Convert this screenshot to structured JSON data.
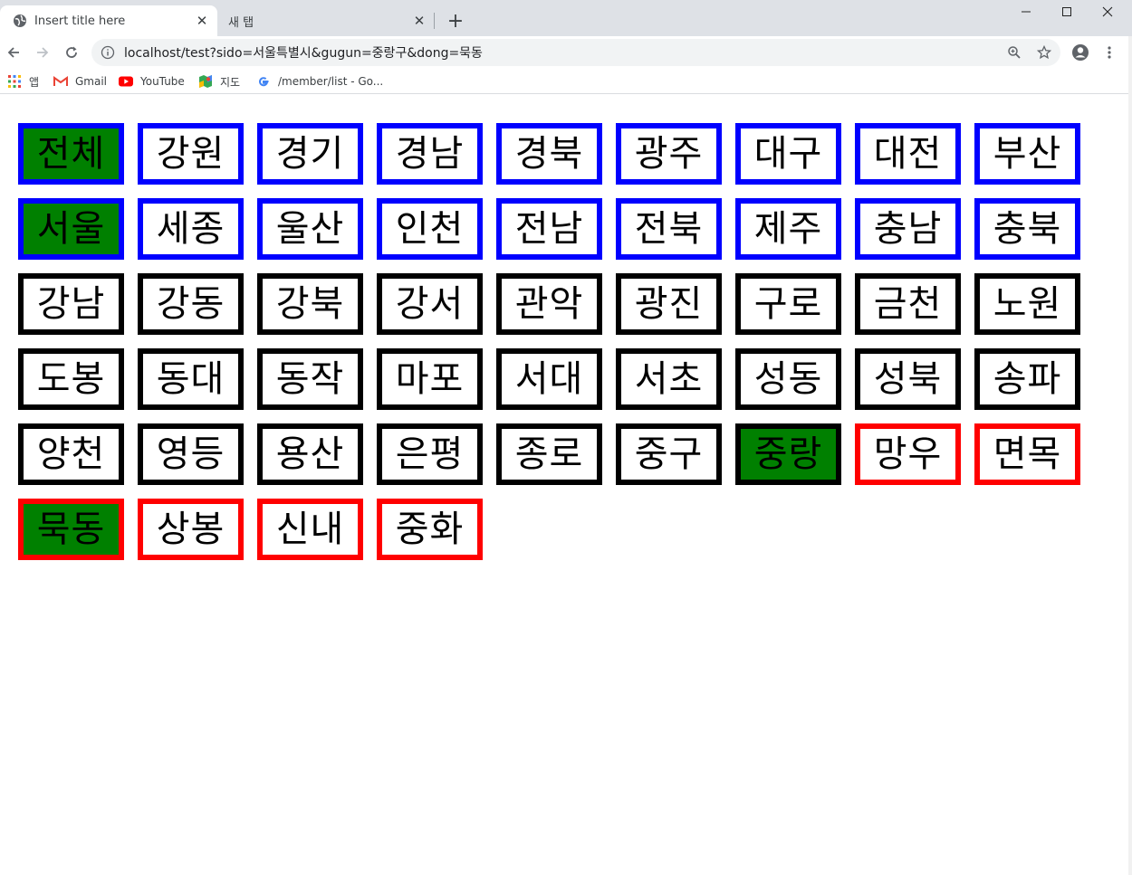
{
  "browser": {
    "tabs": [
      {
        "title": "Insert title here",
        "active": true
      },
      {
        "title": "새 탭",
        "active": false
      }
    ],
    "url": "localhost/test?sido=서울특별시&gugun=중랑구&dong=묵동",
    "bookmarks": [
      "앱",
      "Gmail",
      "YouTube",
      "지도",
      "/member/list - Go..."
    ]
  },
  "colors": {
    "sido_border": "#0000ff",
    "gugun_border": "#000000",
    "dong_border": "#ff0000",
    "selected_fill": "#008000"
  },
  "sido": {
    "items": [
      "전체",
      "강원",
      "경기",
      "경남",
      "경북",
      "광주",
      "대구",
      "대전",
      "부산",
      "서울",
      "세종",
      "울산",
      "인천",
      "전남",
      "전북",
      "제주",
      "충남",
      "충북"
    ],
    "selected": [
      "전체",
      "서울"
    ]
  },
  "gugun": {
    "items": [
      "강남",
      "강동",
      "강북",
      "강서",
      "관악",
      "광진",
      "구로",
      "금천",
      "노원",
      "도봉",
      "동대",
      "동작",
      "마포",
      "서대",
      "서초",
      "성동",
      "성북",
      "송파",
      "양천",
      "영등",
      "용산",
      "은평",
      "종로",
      "중구",
      "중랑"
    ],
    "selected": "중랑"
  },
  "dong": {
    "items": [
      "망우",
      "면목",
      "묵동",
      "상봉",
      "신내",
      "중화"
    ],
    "selected": "묵동"
  }
}
